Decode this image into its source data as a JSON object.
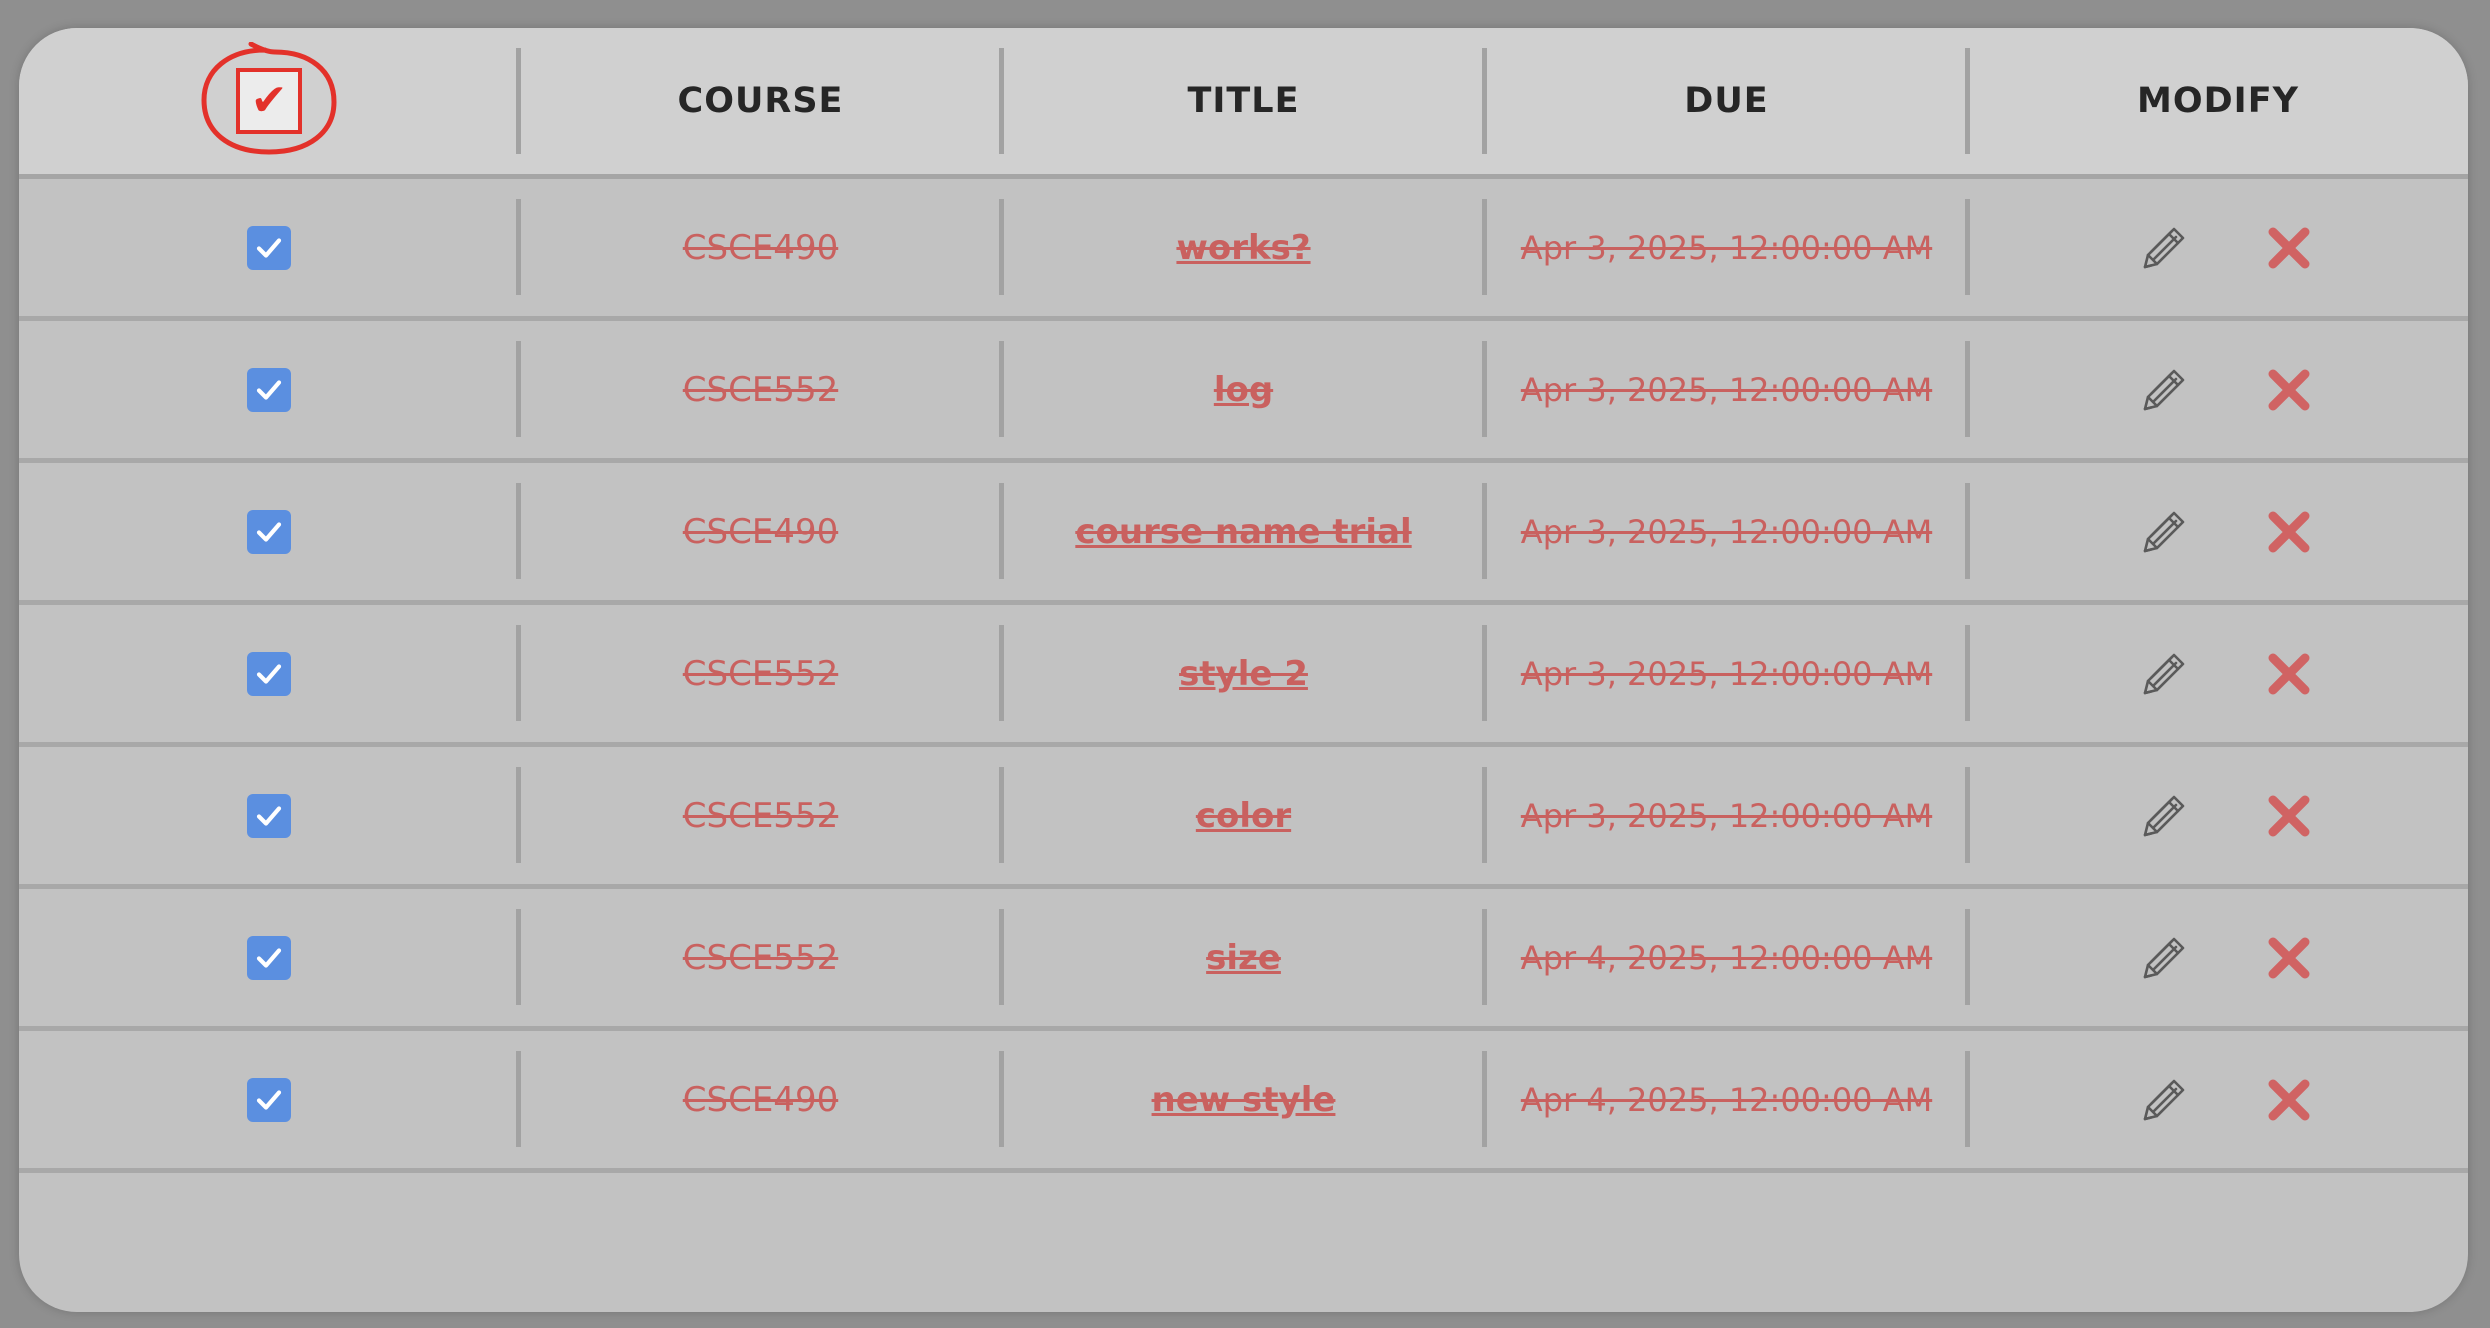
{
  "header": {
    "select_all_mark": "✔",
    "course": "COURSE",
    "title": "TITLE",
    "due": "DUE",
    "modify": "MODIFY"
  },
  "rows": [
    {
      "completed": true,
      "course": "CSCE490",
      "title": "works?",
      "due": "Apr 3, 2025, 12:00:00 AM"
    },
    {
      "completed": true,
      "course": "CSCE552",
      "title": "log",
      "due": "Apr 3, 2025, 12:00:00 AM"
    },
    {
      "completed": true,
      "course": "CSCE490",
      "title": "course name trial",
      "due": "Apr 3, 2025, 12:00:00 AM"
    },
    {
      "completed": true,
      "course": "CSCE552",
      "title": "style 2",
      "due": "Apr 3, 2025, 12:00:00 AM"
    },
    {
      "completed": true,
      "course": "CSCE552",
      "title": "color",
      "due": "Apr 3, 2025, 12:00:00 AM"
    },
    {
      "completed": true,
      "course": "CSCE552",
      "title": "size",
      "due": "Apr 4, 2025, 12:00:00 AM"
    },
    {
      "completed": true,
      "course": "CSCE490",
      "title": "new style",
      "due": "Apr 4, 2025, 12:00:00 AM"
    }
  ],
  "icons": {
    "checkbox": "checkbox-checked-icon",
    "edit": "pencil-icon",
    "delete": "close-x-icon",
    "annotation": "red-circle-annotation"
  },
  "colors": {
    "background": "#8f8f8f",
    "card": "#c2c2c2",
    "header": "#d0d0d0",
    "completed_text": "#c9615f",
    "checkbox": "#5b8fe0",
    "annotation_red": "#e3312a",
    "delete_icon": "#d06363",
    "edit_icon": "#5a5a5a"
  }
}
